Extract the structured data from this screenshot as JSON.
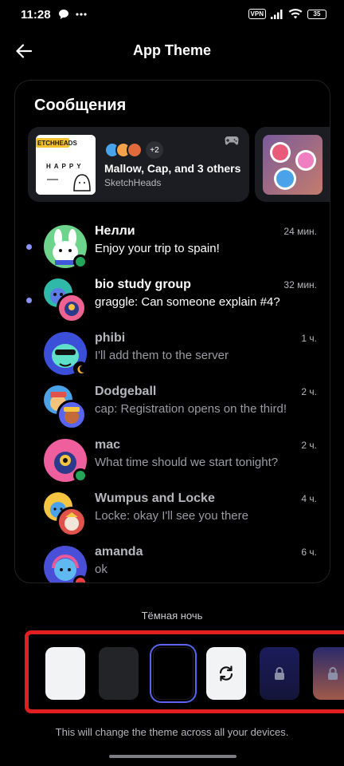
{
  "status_bar": {
    "time": "11:28",
    "vpn": "VPN",
    "battery": "35"
  },
  "header": {
    "title": "App Theme"
  },
  "preview": {
    "heading": "Сообщения",
    "activity": {
      "title": "Mallow, Cap, and 3 others",
      "subtitle": "SketchHeads",
      "more_count": "+2",
      "thumb_text": "HAPPY",
      "thumb_tag": "ETCHHEADS"
    },
    "dms": [
      {
        "name": "Нелли",
        "preview": "Enjoy your trip to spain!",
        "time": "24 мин.",
        "unread": true,
        "presence": "online"
      },
      {
        "name": "bio study group",
        "preview": "graggle: Can someone explain #4?",
        "time": "32 мин.",
        "unread": true,
        "presence": "none"
      },
      {
        "name": "phibi",
        "preview": "I'll add them to the server",
        "time": "1 ч.",
        "unread": false,
        "presence": "idle"
      },
      {
        "name": "Dodgeball",
        "preview": "cap: Registration opens on the third!",
        "time": "2 ч.",
        "unread": false,
        "presence": "none"
      },
      {
        "name": "mac",
        "preview": "What time should we start tonight?",
        "time": "2 ч.",
        "unread": false,
        "presence": "online"
      },
      {
        "name": "Wumpus and Locke",
        "preview": "Locke: okay I'll see you there",
        "time": "4 ч.",
        "unread": false,
        "presence": "none"
      },
      {
        "name": "amanda",
        "preview": "ok",
        "time": "6 ч.",
        "unread": false,
        "presence": "dnd"
      }
    ]
  },
  "theme": {
    "current_label": "Тёмная ночь",
    "footnote": "This will change the theme across all your devices.",
    "swatches": [
      {
        "name": "light",
        "color": "#f2f3f5",
        "icon": ""
      },
      {
        "name": "dark",
        "color": "#232428",
        "icon": ""
      },
      {
        "name": "midnight",
        "color": "#000000",
        "icon": "",
        "selected": true
      },
      {
        "name": "sync",
        "color": "#f2f3f5",
        "icon": "sync-icon"
      },
      {
        "name": "locked-gradient-1",
        "color": "#1b1c5a",
        "icon": "lock-icon"
      },
      {
        "name": "locked-gradient-2",
        "color": "#3a2a55",
        "icon": "lock-icon"
      }
    ]
  },
  "colors": {
    "accent": "#5865f2",
    "online": "#23a55a",
    "idle": "#f0b232",
    "dnd": "#f23f43",
    "unread": "#8a92ff",
    "highlight": "#e02020"
  }
}
